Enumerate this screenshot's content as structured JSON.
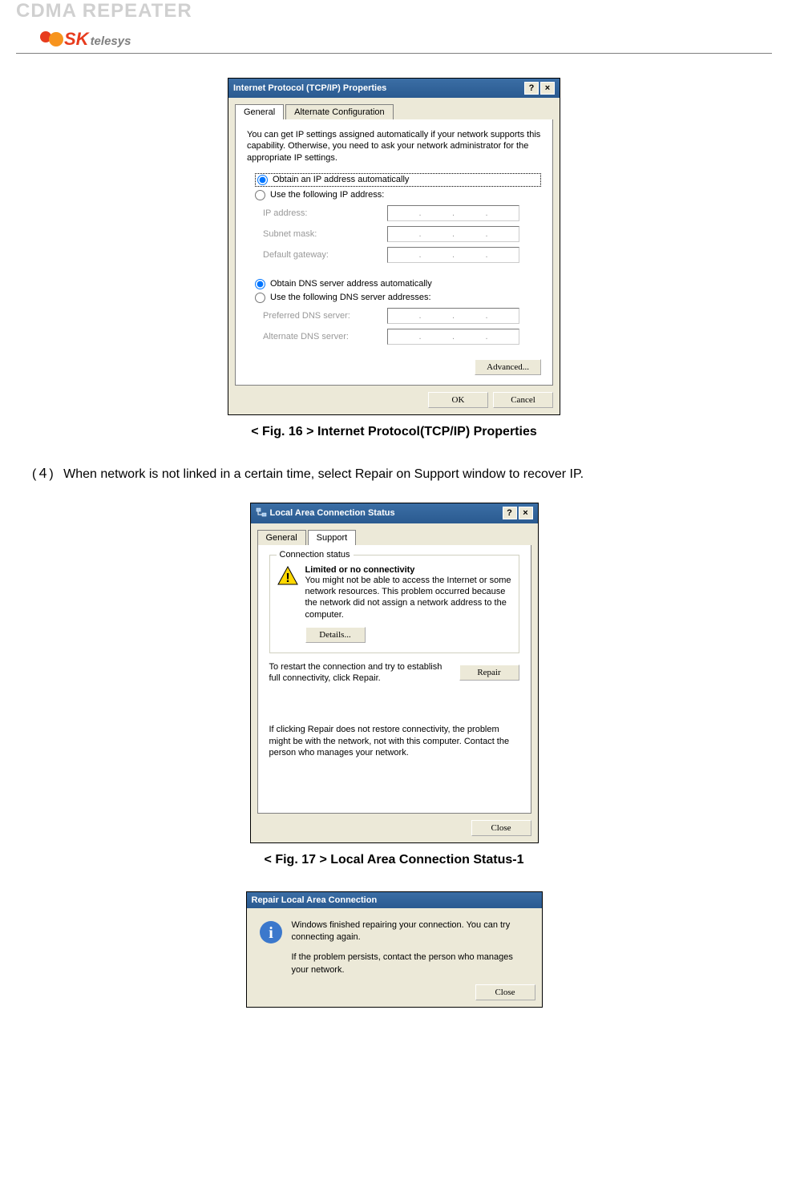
{
  "header": {
    "title": "CDMA REPEATER",
    "logo_sk": "SK",
    "logo_telesys": "telesys"
  },
  "fig16": {
    "titlebar": "Internet Protocol (TCP/IP) Properties",
    "tabs": [
      "General",
      "Alternate Configuration"
    ],
    "desc": "You can get IP settings assigned automatically if your network supports this capability. Otherwise, you need to ask your network administrator for the appropriate IP settings.",
    "radio_obtain_ip": "Obtain an IP address automatically",
    "radio_use_ip": "Use the following IP address:",
    "fields": {
      "ip": "IP address:",
      "subnet": "Subnet mask:",
      "gateway": "Default gateway:"
    },
    "radio_obtain_dns": "Obtain DNS server address automatically",
    "radio_use_dns": "Use the following DNS server addresses:",
    "dns_fields": {
      "preferred": "Preferred DNS server:",
      "alternate": "Alternate DNS server:"
    },
    "advanced_btn": "Advanced...",
    "ok_btn": "OK",
    "cancel_btn": "Cancel",
    "caption": "< Fig. 16 > Internet Protocol(TCP/IP) Properties"
  },
  "step4": {
    "num": "(４)",
    "text": "When network is not linked in a certain time, select Repair on Support window to recover IP."
  },
  "fig17": {
    "titlebar": "Local Area Connection Status",
    "tabs": [
      "General",
      "Support"
    ],
    "fieldset_title": "Connection status",
    "warning_title": "Limited or no connectivity",
    "warning_body": "You might not be able to access the Internet or some network resources. This problem occurred because the network did not assign a network address to the computer.",
    "details_btn": "Details...",
    "repair_text": "To restart the connection and try to establish full connectivity, click Repair.",
    "repair_btn": "Repair",
    "note_text": "If clicking Repair does not restore connectivity, the problem might be with the network, not with this computer. Contact the person who manages your network.",
    "close_btn": "Close",
    "caption": "< Fig. 17 > Local Area Connection Status-1"
  },
  "repair_dialog": {
    "titlebar": "Repair Local Area Connection",
    "line1": "Windows finished repairing your connection. You can try connecting again.",
    "line2": "If the problem persists, contact the person who manages your network.",
    "close_btn": "Close"
  }
}
